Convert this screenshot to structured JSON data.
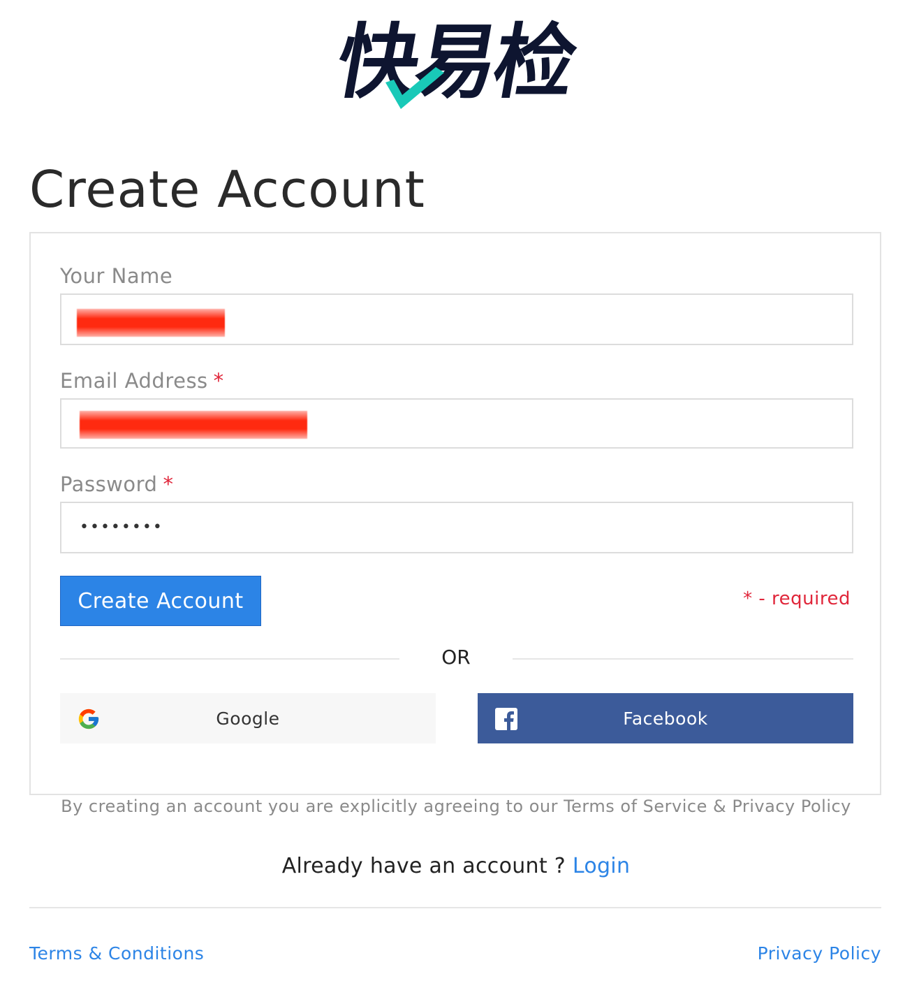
{
  "brand": {
    "logo_text": "快易检"
  },
  "page": {
    "title": "Create Account"
  },
  "form": {
    "name": {
      "label": "Your Name",
      "value": ""
    },
    "email": {
      "label": "Email Address",
      "required_mark": "*",
      "value": ""
    },
    "password": {
      "label": "Password",
      "required_mark": "*",
      "value": "••••••••"
    },
    "submit_label": "Create Account",
    "required_note": "* - required",
    "divider_text": "OR"
  },
  "social": {
    "google_label": "Google",
    "facebook_label": "Facebook",
    "google_icon": "google-g-icon",
    "facebook_icon": "facebook-f-icon"
  },
  "legal": {
    "agreement": "By creating an account you are explicitly agreeing to our Terms of Service & Privacy Policy"
  },
  "login_prompt": {
    "text": "Already have an account ?",
    "link": "Login"
  },
  "footer": {
    "terms": "Terms & Conditions",
    "privacy": "Privacy Policy"
  },
  "colors": {
    "accent": "#2c84e6",
    "required": "#e0263a",
    "facebook": "#3c5b9a",
    "logo_dark": "#0e1530",
    "logo_check": "#19c9b8"
  }
}
